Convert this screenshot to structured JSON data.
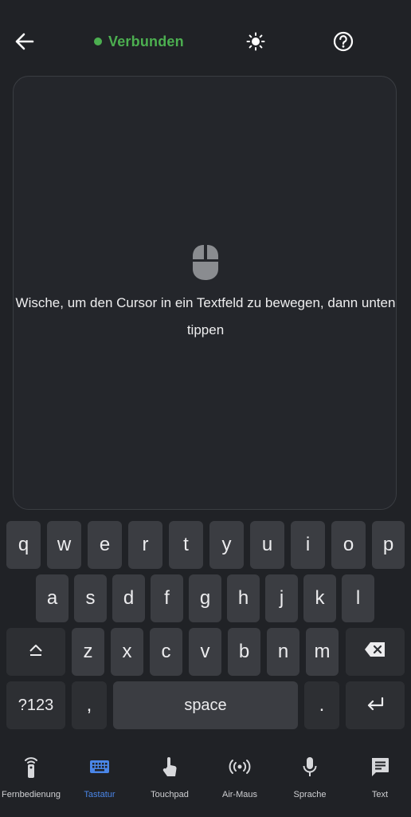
{
  "header": {
    "status": "Verbunden",
    "status_color": "#4caf50",
    "icons": [
      "back-arrow-icon",
      "brightness-icon",
      "help-icon"
    ]
  },
  "touchpad": {
    "hint": "Wische, um den Cursor in ein Textfeld zu bewegen, dann unten tippen",
    "icon": "mouse-icon"
  },
  "keyboard": {
    "row1": [
      "q",
      "w",
      "e",
      "r",
      "t",
      "y",
      "u",
      "i",
      "o",
      "p"
    ],
    "row2": [
      "a",
      "s",
      "d",
      "f",
      "g",
      "h",
      "j",
      "k",
      "l"
    ],
    "row3": [
      "z",
      "x",
      "c",
      "v",
      "b",
      "n",
      "m"
    ],
    "symbols_label": "?123",
    "comma_label": ",",
    "space_label": "space",
    "period_label": ".",
    "icons": [
      "shift-icon",
      "backspace-icon",
      "enter-icon"
    ]
  },
  "nav": {
    "active_color": "#4a86e8",
    "items": [
      {
        "label": "Fernbedienung",
        "icon": "remote-icon"
      },
      {
        "label": "Tastatur",
        "icon": "keyboard-icon"
      },
      {
        "label": "Touchpad",
        "icon": "touch-icon"
      },
      {
        "label": "Air-Maus",
        "icon": "air-mouse-icon"
      },
      {
        "label": "Sprache",
        "icon": "microphone-icon"
      },
      {
        "label": "Text",
        "icon": "text-message-icon"
      }
    ]
  }
}
